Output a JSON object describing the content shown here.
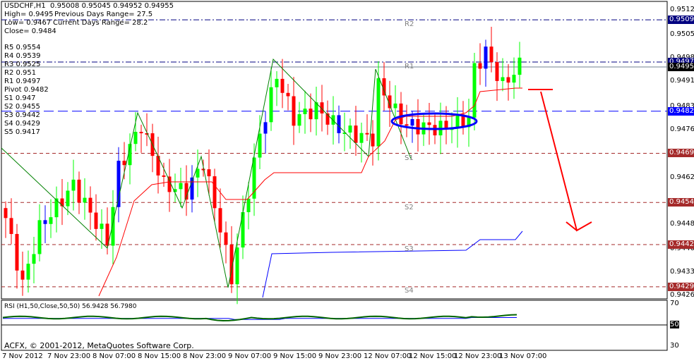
{
  "header": {
    "symbol_line": "USDCHF,H1  0.95008 0.95045 0.94952 0.94955",
    "high": "High= 0.9495",
    "prev_range": "Previous Days Range= 27.5",
    "low": "Low= 0.9467",
    "cur_range": "Current Days Range= 28.2",
    "close": "Close= 0.9484"
  },
  "pivots": [
    "R5 0.9554",
    "R4 0.9539",
    "R3 0.9525",
    "R2 0.951",
    "R1 0.9497",
    "Pivot 0.9482",
    "S1 0.947",
    "S2 0.9455",
    "S3 0.9442",
    "S4 0.9429",
    "S5 0.9417"
  ],
  "level_labels": {
    "r2": "R2",
    "r1": "R1",
    "s1": "S1",
    "s2": "S2",
    "s3": "S3",
    "s4": "S4"
  },
  "price_axis": [
    "0.95125",
    "0.95050",
    "0.94980",
    "0.94910",
    "0.94835",
    "0.94765",
    "0.94620",
    "0.94480",
    "0.94405",
    "0.94335",
    "0.94265"
  ],
  "price_tags": [
    {
      "text": "0.95097",
      "price": 0.95097,
      "color": "#000080"
    },
    {
      "text": "0.94970",
      "price": 0.9497,
      "color": "#000080"
    },
    {
      "text": "0.94955",
      "price": 0.94955,
      "color": "#000000"
    },
    {
      "text": "0.94822",
      "price": 0.94822,
      "color": "#0000ff"
    },
    {
      "text": "0.94695",
      "price": 0.94695,
      "color": "#a52a2a"
    },
    {
      "text": "0.94547",
      "price": 0.94547,
      "color": "#a52a2a"
    },
    {
      "text": "0.94420",
      "price": 0.9442,
      "color": "#a52a2a"
    },
    {
      "text": "0.94293",
      "price": 0.94293,
      "color": "#a52a2a"
    }
  ],
  "rsi": {
    "label": "RSI (H1,50,Close,50,50) 56.9428 56.7980",
    "axis": [
      "70",
      "50",
      "30"
    ]
  },
  "copyright": "ACFX, © 2001-2012, MetaQuotes Software Corp.",
  "time_axis": [
    "7 Nov 2012",
    "7 Nov 23:00",
    "8 Nov 07:00",
    "8 Nov 15:00",
    "8 Nov 23:00",
    "9 Nov 07:00",
    "9 Nov 15:00",
    "9 Nov 23:00",
    "12 Nov 07:00",
    "12 Nov 15:00",
    "12 Nov 23:00",
    "13 Nov 07:00"
  ],
  "chart_data": {
    "type": "candlestick",
    "symbol": "USDCHF",
    "timeframe": "H1",
    "ylim": [
      0.94265,
      0.95125
    ],
    "close_path": [
      [
        0,
        0.945
      ],
      [
        3,
        0.943
      ],
      [
        6,
        0.9447
      ],
      [
        12,
        0.946
      ],
      [
        18,
        0.9443
      ],
      [
        20,
        0.9465
      ],
      [
        24,
        0.9478
      ],
      [
        28,
        0.946
      ],
      [
        32,
        0.9458
      ],
      [
        35,
        0.9467
      ],
      [
        38,
        0.9447
      ],
      [
        40,
        0.9432
      ],
      [
        42,
        0.945
      ],
      [
        45,
        0.9475
      ],
      [
        48,
        0.9493
      ],
      [
        51,
        0.948
      ],
      [
        55,
        0.9483
      ],
      [
        59,
        0.9477
      ],
      [
        62,
        0.9475
      ],
      [
        65,
        0.9474
      ],
      [
        66,
        0.949
      ],
      [
        69,
        0.9482
      ],
      [
        71,
        0.9478
      ],
      [
        77,
        0.9477
      ],
      [
        82,
        0.948
      ],
      [
        83,
        0.9495
      ],
      [
        85,
        0.95
      ],
      [
        88,
        0.949
      ],
      [
        91,
        0.9496
      ]
    ]
  }
}
